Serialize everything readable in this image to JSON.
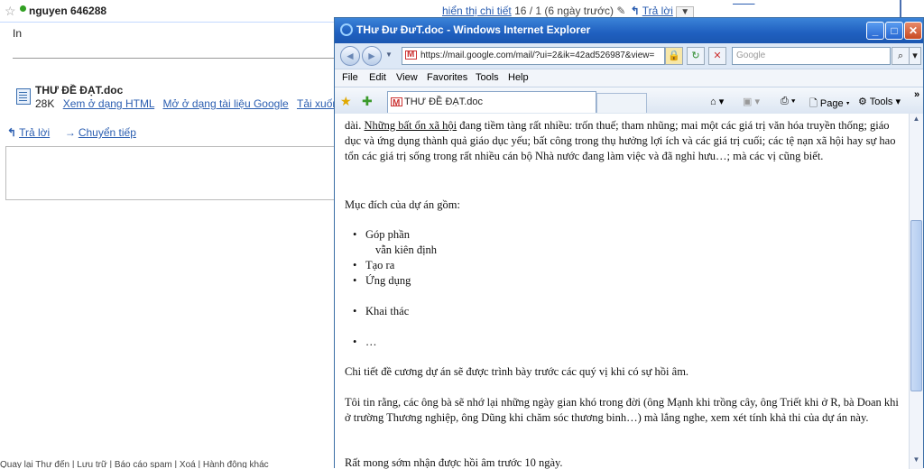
{
  "gmail": {
    "sender": "nguyen 646288",
    "header_link": "hiển thị chi tiết",
    "header_date": "16 / 1 (6 ngày trước)",
    "header_reply": "Trả lời",
    "recipient": "In",
    "attachment": {
      "name": "THƯ ĐỀ ĐẠT.doc",
      "size": "28K",
      "view_html": "Xem ở dạng HTML",
      "open_docs": "Mở ở dạng tài liệu Google",
      "download": "Tải xuống"
    },
    "reply": "Trả lời",
    "forward": "Chuyển tiếp",
    "bottom_text": "Quay lại Thư đến  |  Lưu trữ  |  Báo cáo spam  |  Xoá  |  Hành động khác"
  },
  "ie": {
    "title": "THư Đư ĐưT.doc - Windows Internet Explorer",
    "url": "https://mail.google.com/mail/?ui=2&ik=42ad526987&view=",
    "search_placeholder": "Google",
    "menu": [
      "File",
      "Edit",
      "View",
      "Favorites",
      "Tools",
      "Help"
    ],
    "tab_title": "THƯ ĐỀ ĐẠT.doc",
    "toolbar": {
      "page": "Page",
      "tools": "Tools"
    }
  },
  "document": {
    "para1_start": "dài. ",
    "para1_link": "Những bất ổn xã hội",
    "para1_end": " đang tiềm tàng rất nhiều: trốn thuế; tham nhũng; mai một các giá trị văn hóa truyền thống; giáo dục và ứng dụng thành quả giáo dục yếu; bất công trong thụ hưởng lợi ích và các giá trị cuối; các tệ nạn xã hội hay sự hao tổn các giá trị sống trong rất nhiều cán bộ Nhà nước đang làm việc và đã nghỉ hưu…; mà các vị cũng biết.",
    "purpose_heading": "Mục  đích của dự án gồm:",
    "bullets": [
      "Góp phần",
      "vẫn kiên định",
      "Tạo ra",
      "Ứng dụng",
      "Khai thác",
      "…"
    ],
    "para_detail": "Chi tiết  đề cương dự án sẽ được trình bày trước các quý vị khi có sự hồi âm.",
    "para_belief": "Tôi tin rằng, các ông bà sẽ nhớ lại những ngày gian khó trong đời (ông Mạnh khi trồng cây, ông Triết khi ở R, bà Doan khi ở trường Thương nghiệp, ông Dũng khi chăm sóc thương binh…) mà lắng nghe, xem xét tính khả thi của dự án này.",
    "para_closing": "Rất mong sớm nhận được hồi âm trước 10 ngày."
  }
}
